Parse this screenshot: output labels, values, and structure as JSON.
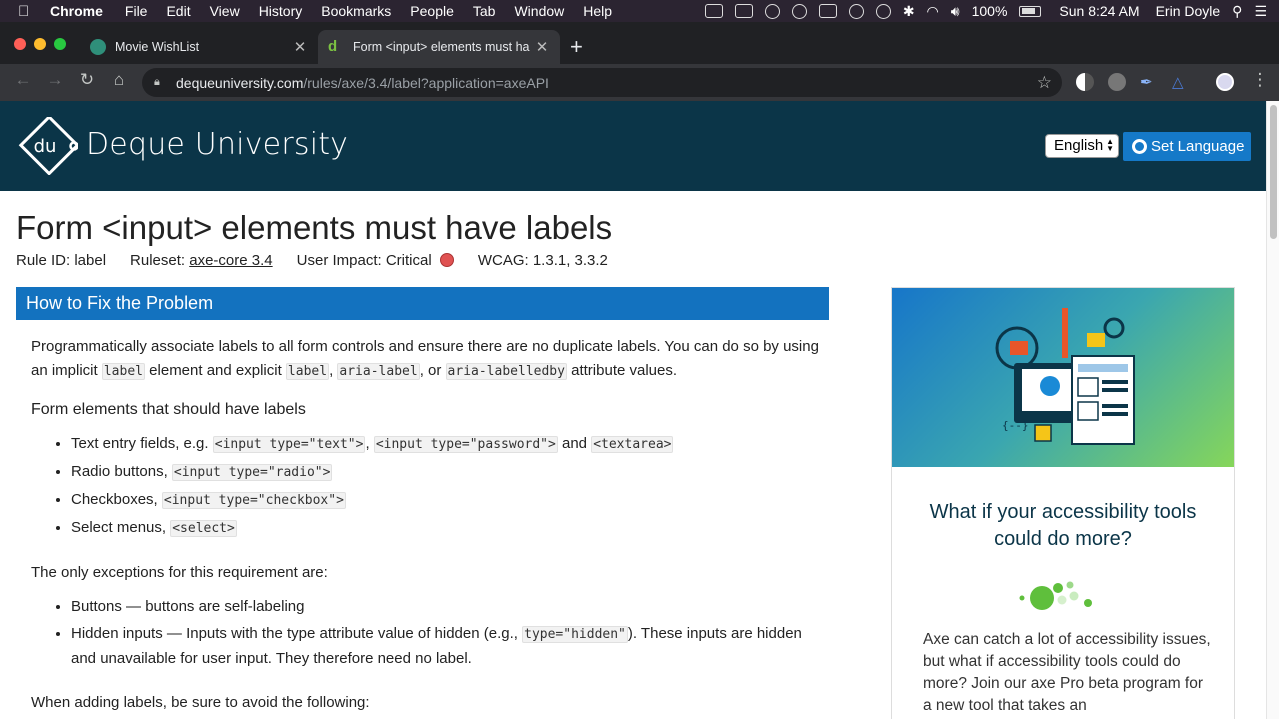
{
  "menubar": {
    "app": "Chrome",
    "items": [
      "File",
      "Edit",
      "View",
      "History",
      "Bookmarks",
      "People",
      "Tab",
      "Window",
      "Help"
    ],
    "battery": "100%",
    "clock": "Sun 8:24 AM",
    "user": "Erin Doyle"
  },
  "tabs": [
    {
      "title": "Movie WishList",
      "active": false
    },
    {
      "title": "Form <input> elements must ha",
      "active": true
    }
  ],
  "omnibox": {
    "host": "dequeuniversity.com",
    "path": "/rules/axe/3.4/label?application=axeAPI"
  },
  "header": {
    "logo_mark": "du",
    "logo_text": "Deque University",
    "language_value": "English",
    "set_language_label": "Set Language"
  },
  "article": {
    "title": "Form <input> elements must have labels",
    "rule_id": "Rule ID: label",
    "ruleset_label": "Ruleset:",
    "ruleset_link": "axe-core 3.4",
    "impact": "User Impact: Critical",
    "wcag": "WCAG: 1.3.1, 3.3.2",
    "section_heading": "How to Fix the Problem",
    "intro_1": "Programmatically associate labels to all form controls and ensure there are no duplicate labels. You can do so by using an implicit",
    "code_label": "label",
    "intro_2": "element and explicit",
    "code_label2": "label",
    "code_aria_label": "aria-label",
    "intro_3": ", or",
    "code_labelledby": "aria-labelledby",
    "intro_4": "attribute values.",
    "subheading": "Form elements that should have labels",
    "list1": [
      {
        "text": "Text entry fields, e.g.",
        "codes": [
          "<input type=\"text\">",
          "<input type=\"password\">",
          "<textarea>"
        ],
        "and": "and"
      },
      {
        "text": "Radio buttons,",
        "codes": [
          "<input type=\"radio\">"
        ]
      },
      {
        "text": "Checkboxes,",
        "codes": [
          "<input type=\"checkbox\">"
        ]
      },
      {
        "text": "Select menus,",
        "codes": [
          "<select>"
        ]
      }
    ],
    "exceptions_heading": "The only exceptions for this requirement are:",
    "exceptions": {
      "buttons": "Buttons — buttons are self-labeling",
      "hidden_1": "Hidden inputs — Inputs with the type attribute value of hidden (e.g.,",
      "hidden_code": "type=\"hidden\"",
      "hidden_2": "). These inputs are hidden and unavailable for user input. They therefore need no label."
    },
    "avoid_heading": "When adding labels, be sure to avoid the following:"
  },
  "sidebar": {
    "card_title": "What if your accessibility tools could do more?",
    "card_body": "Axe can catch a lot of accessibility issues, but what if accessibility tools could do more? Join our axe Pro beta program for a new tool that takes an"
  },
  "colors": {
    "header_bg": "#0b3548",
    "accent": "#1372bf",
    "critical": "#e05252"
  }
}
